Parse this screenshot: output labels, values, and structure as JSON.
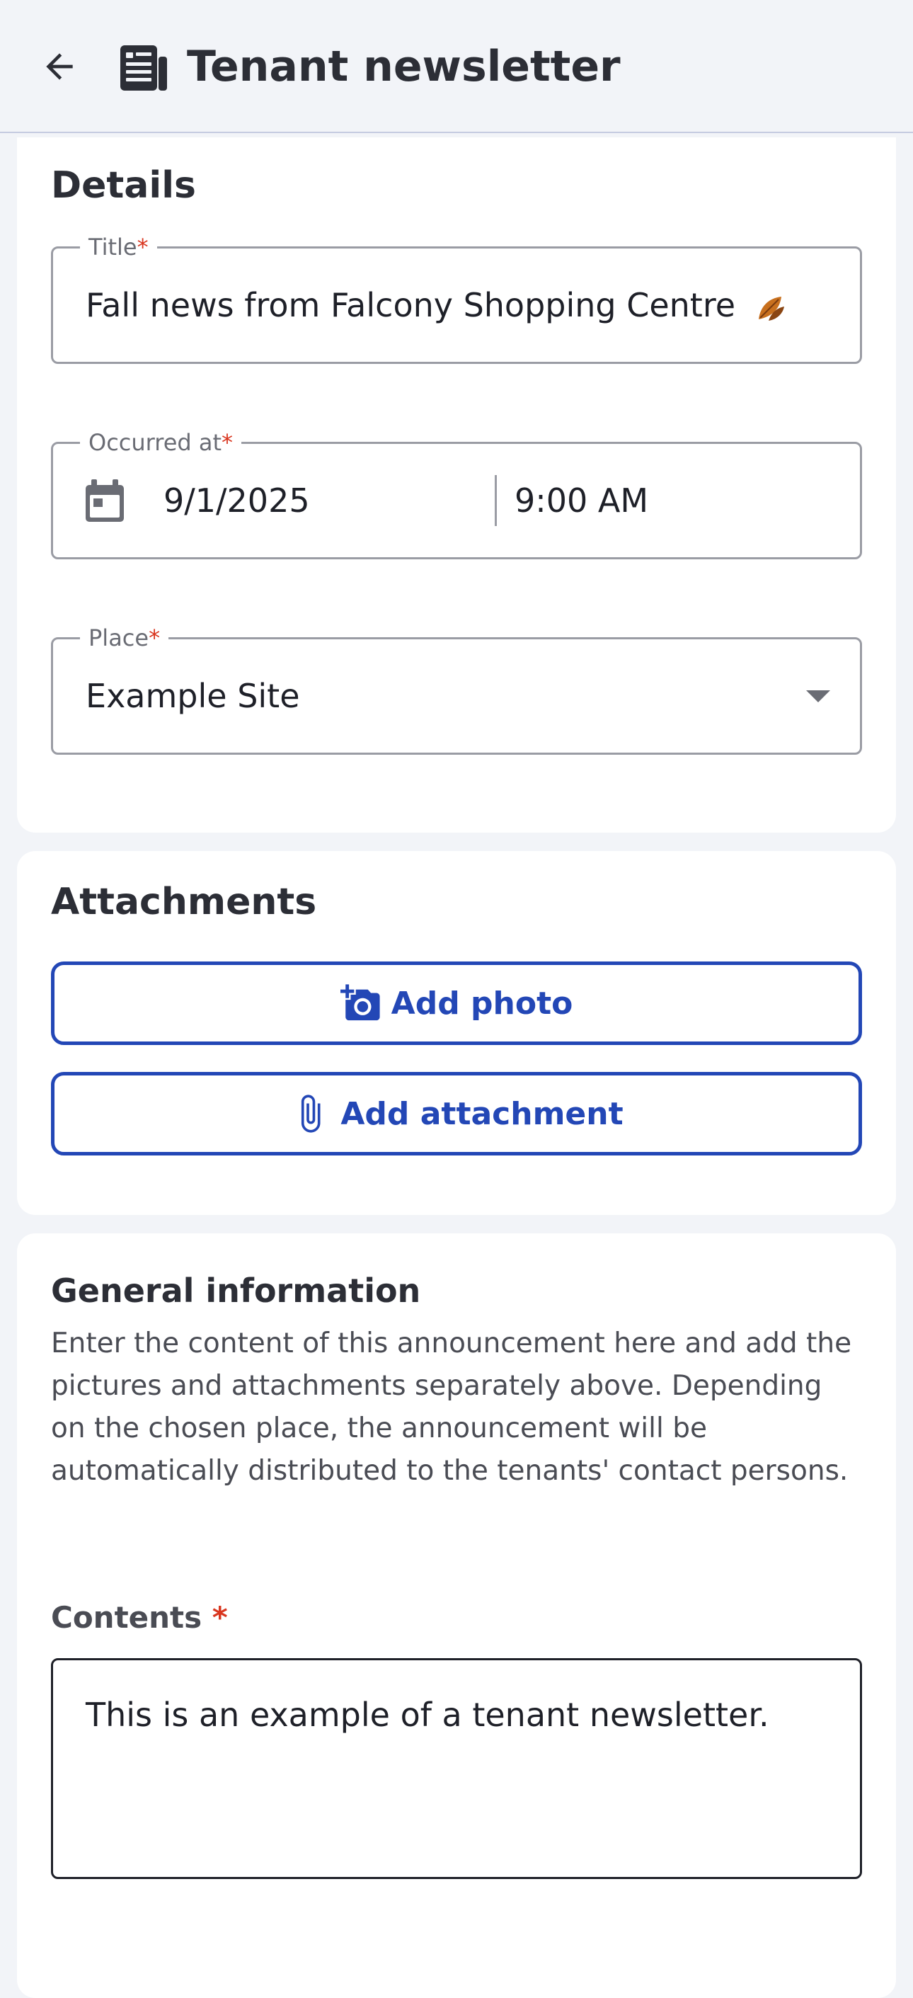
{
  "header": {
    "title": "Tenant newsletter",
    "back_icon": "arrow-left-icon",
    "title_icon": "newspaper-icon"
  },
  "details": {
    "heading": "Details",
    "title_field": {
      "label": "Title",
      "required_mark": "*",
      "value": "Fall news from Falcony Shopping Centre",
      "emoji_icon": "fallen-leaf-icon"
    },
    "occurred_field": {
      "label": "Occurred at",
      "required_mark": "*",
      "date": "9/1/2025",
      "time": "9:00 AM",
      "icon": "calendar-icon"
    },
    "place_field": {
      "label": "Place",
      "required_mark": "*",
      "value": "Example Site",
      "icon": "dropdown-arrow-icon"
    }
  },
  "attachments": {
    "heading": "Attachments",
    "add_photo_label": "Add photo",
    "add_photo_icon": "add-photo-icon",
    "add_attachment_label": "Add attachment",
    "add_attachment_icon": "paperclip-icon"
  },
  "general": {
    "heading": "General information",
    "description": "Enter the content of this announcement here and add the pictures and attachments separately above. Depending on the chosen place, the announcement will be automatically distributed to the tenants' contact persons.",
    "contents_label": "Contents",
    "contents_required_mark": "*",
    "contents_value": "This is an example of a tenant newsletter."
  },
  "colors": {
    "accent": "#2347b6",
    "required": "#d9361f",
    "background": "#f2f4f8",
    "card": "#ffffff"
  }
}
